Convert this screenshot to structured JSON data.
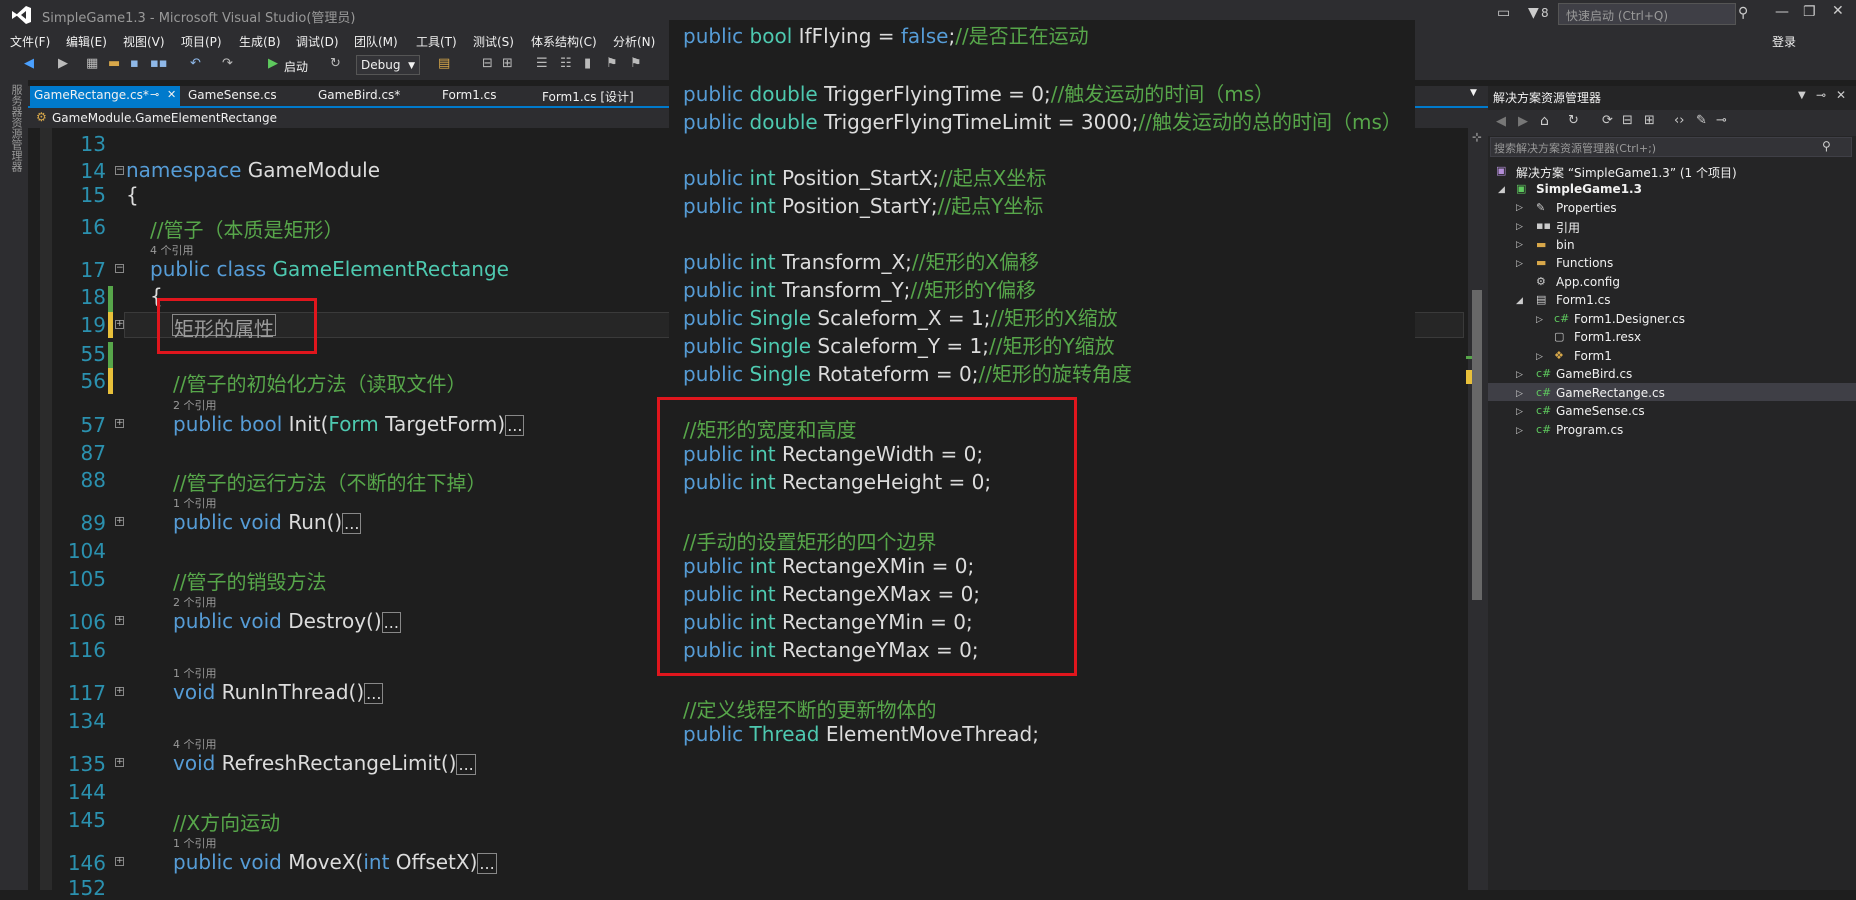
{
  "window": {
    "title": "SimpleGame1.3 - Microsoft Visual Studio(管理员)",
    "notification_count": "8",
    "quick_launch_placeholder": "快速启动 (Ctrl+Q)",
    "login": "登录"
  },
  "menu": [
    "文件(F)",
    "编辑(E)",
    "视图(V)",
    "项目(P)",
    "生成(B)",
    "调试(D)",
    "团队(M)",
    "工具(T)",
    "测试(S)",
    "体系结构(C)",
    "分析(N)"
  ],
  "toolbar": {
    "start_label": "启动",
    "config": "Debug"
  },
  "left_strip": {
    "label": "服务器资源管理器"
  },
  "tabs": [
    "GameRectange.cs*",
    "GameSense.cs",
    "GameBird.cs*",
    "Form1.cs",
    "Form1.cs [设计]"
  ],
  "navbar": {
    "path": "GameModule.GameElementRectange"
  },
  "editor": {
    "line_numbers": [
      "13",
      "14",
      "15",
      "16",
      "17",
      "18",
      "19",
      "55",
      "56",
      "57",
      "87",
      "88",
      "89",
      "104",
      "105",
      "106",
      "116",
      "117",
      "134",
      "135",
      "144",
      "145",
      "146",
      "152"
    ],
    "refs": {
      "r4": "4 个引用",
      "r2a": "2 个引用",
      "r1a": "1 个引用",
      "r2b": "2 个引用",
      "r1b": "1 个引用",
      "r4b": "4 个引用",
      "r1c": "1 个引用"
    },
    "namespace_kw": "namespace",
    "namespace_name": "GameModule",
    "open_brace": "{",
    "comment_pipe": "//管子（本质是矩形）",
    "class_kw": "public class",
    "class_name": "GameElementRectange",
    "region_label": "矩形的属性",
    "comment_init": "//管子的初始化方法（读取文件）",
    "init_sig_a": "public bool",
    "init_sig_b": " Init(",
    "init_sig_c": "Form",
    "init_sig_d": " TargetForm)",
    "comment_run": "//管子的运行方法（不断的往下掉）",
    "run_sig_a": "public void",
    "run_sig_b": " Run()",
    "comment_destroy": "//管子的销毁方法",
    "destroy_sig_a": "public void",
    "destroy_sig_b": " Destroy()",
    "thread_sig_a": "void",
    "thread_sig_b": " RunInThread()",
    "limit_sig_a": "void",
    "limit_sig_b": " RefreshRectangeLimit()",
    "comment_movex": "//X方向运动",
    "movex_sig_a": "public void",
    "movex_sig_b": " MoveX(",
    "movex_sig_c": "int",
    "movex_sig_d": " OffsetX)",
    "ellipsis": "..."
  },
  "peek": {
    "lines": [
      {
        "kw": "public",
        "ty": " bool",
        "pl": " IfFlying = ",
        "kw2": "false",
        "pl2": ";",
        "cm": "//是否正在运动"
      },
      {
        "kw": "public",
        "ty": " double",
        "pl": " TriggerFlyingTime = 0;",
        "cm": "//触发运动的时间（ms）"
      },
      {
        "kw": "public",
        "ty": " double",
        "pl": " TriggerFlyingTimeLimit = 3000;",
        "cm": "//触发运动的总的时间（ms）"
      },
      {
        "kw": "public",
        "ty": " int",
        "pl": " Position_StartX;",
        "cm": "//起点X坐标"
      },
      {
        "kw": "public",
        "ty": " int",
        "pl": " Position_StartY;",
        "cm": "//起点Y坐标"
      },
      {
        "kw": "public",
        "ty": " int",
        "pl": " Transform_X;",
        "cm": "//矩形的X偏移"
      },
      {
        "kw": "public",
        "ty": " int",
        "pl": " Transform_Y;",
        "cm": "//矩形的Y偏移"
      },
      {
        "kw": "public",
        "ty": " Single",
        "pl": " Scaleform_X = 1;",
        "cm": "//矩形的X缩放"
      },
      {
        "kw": "public",
        "ty": " Single",
        "pl": " Scaleform_Y = 1;",
        "cm": "//矩形的Y缩放"
      },
      {
        "kw": "public",
        "ty": " Single",
        "pl": " Rotateform = 0;",
        "cm": "//矩形的旋转角度"
      },
      {
        "cm": "//矩形的宽度和高度"
      },
      {
        "kw": "public",
        "ty": " int",
        "pl": " RectangeWidth = 0;"
      },
      {
        "kw": "public",
        "ty": " int",
        "pl": " RectangeHeight = 0;"
      },
      {
        "cm": "//手动的设置矩形的四个边界"
      },
      {
        "kw": "public",
        "ty": " int",
        "pl": " RectangeXMin = 0;"
      },
      {
        "kw": "public",
        "ty": " int",
        "pl": " RectangeXMax = 0;"
      },
      {
        "kw": "public",
        "ty": " int",
        "pl": " RectangeYMin = 0;"
      },
      {
        "kw": "public",
        "ty": " int",
        "pl": " RectangeYMax = 0;"
      },
      {
        "cm": "//定义线程不断的更新物体的"
      },
      {
        "kw": "public",
        "ty": " Thread",
        "pl": " ElementMoveThread;"
      }
    ]
  },
  "solution_explorer": {
    "title": "解决方案资源管理器",
    "search_placeholder": "搜索解决方案资源管理器(Ctrl+;)",
    "items": [
      {
        "label": "解决方案 “SimpleGame1.3” (1 个项目)"
      },
      {
        "label": "SimpleGame1.3"
      },
      {
        "label": "Properties"
      },
      {
        "label": "引用"
      },
      {
        "label": "bin"
      },
      {
        "label": "Functions"
      },
      {
        "label": "App.config"
      },
      {
        "label": "Form1.cs"
      },
      {
        "label": "Form1.Designer.cs"
      },
      {
        "label": "Form1.resx"
      },
      {
        "label": "Form1"
      },
      {
        "label": "GameBird.cs"
      },
      {
        "label": "GameRectange.cs"
      },
      {
        "label": "GameSense.cs"
      },
      {
        "label": "Program.cs"
      }
    ]
  }
}
